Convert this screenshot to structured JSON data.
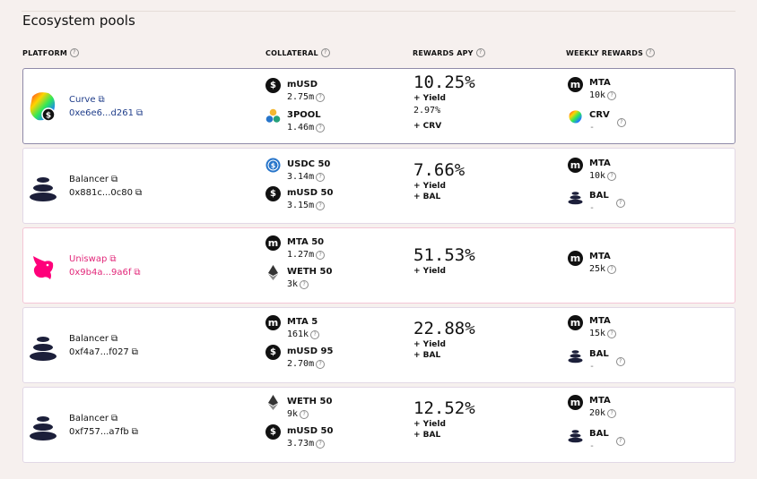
{
  "section_title": "Ecosystem pools",
  "headers": {
    "platform": "PLATFORM",
    "collateral": "COLLATERAL",
    "rewards_apy": "REWARDS APY",
    "weekly_rewards": "WEEKLY REWARDS"
  },
  "pools": [
    {
      "platform": "Curve",
      "address": "0xe6e6...d261",
      "collateral": [
        {
          "name": "mUSD",
          "value": "2.75m",
          "icon": "musd-icon"
        },
        {
          "name": "3POOL",
          "value": "1.46m",
          "icon": "3pool-icon"
        }
      ],
      "apy": "10.25%",
      "lines": [
        "+ Yield",
        "2.97%",
        "+ CRV"
      ],
      "rewards": [
        {
          "name": "MTA",
          "value": "10k",
          "icon": "mta-icon"
        },
        {
          "name": "CRV",
          "value": "-",
          "icon": "crv-icon"
        }
      ]
    },
    {
      "platform": "Balancer",
      "address": "0x881c...0c80",
      "collateral": [
        {
          "name": "USDC 50",
          "value": "3.14m",
          "icon": "usdc-icon"
        },
        {
          "name": "mUSD 50",
          "value": "3.15m",
          "icon": "musd-icon"
        }
      ],
      "apy": "7.66%",
      "lines": [
        "+ Yield",
        "+ BAL"
      ],
      "rewards": [
        {
          "name": "MTA",
          "value": "10k",
          "icon": "mta-icon"
        },
        {
          "name": "BAL",
          "value": "-",
          "icon": "bal-icon"
        }
      ]
    },
    {
      "platform": "Uniswap",
      "address": "0x9b4a...9a6f",
      "collateral": [
        {
          "name": "MTA 50",
          "value": "1.27m",
          "icon": "mta-icon"
        },
        {
          "name": "WETH 50",
          "value": "3k",
          "icon": "weth-icon"
        }
      ],
      "apy": "51.53%",
      "lines": [
        "+ Yield"
      ],
      "rewards": [
        {
          "name": "MTA",
          "value": "25k",
          "icon": "mta-icon"
        }
      ]
    },
    {
      "platform": "Balancer",
      "address": "0xf4a7...f027",
      "collateral": [
        {
          "name": "MTA 5",
          "value": "161k",
          "icon": "mta-icon"
        },
        {
          "name": "mUSD 95",
          "value": "2.70m",
          "icon": "musd-icon"
        }
      ],
      "apy": "22.88%",
      "lines": [
        "+ Yield",
        "+ BAL"
      ],
      "rewards": [
        {
          "name": "MTA",
          "value": "15k",
          "icon": "mta-icon"
        },
        {
          "name": "BAL",
          "value": "-",
          "icon": "bal-icon"
        }
      ]
    },
    {
      "platform": "Balancer",
      "address": "0xf757...a7fb",
      "collateral": [
        {
          "name": "WETH 50",
          "value": "9k",
          "icon": "weth-icon"
        },
        {
          "name": "mUSD 50",
          "value": "3.73m",
          "icon": "musd-icon"
        }
      ],
      "apy": "12.52%",
      "lines": [
        "+ Yield",
        "+ BAL"
      ],
      "rewards": [
        {
          "name": "MTA",
          "value": "20k",
          "icon": "mta-icon"
        },
        {
          "name": "BAL",
          "value": "-",
          "icon": "bal-icon"
        }
      ]
    }
  ],
  "colors": {
    "curve_link": "#1f3d8a",
    "uniswap_link": "#e2287a",
    "balancer_link": "#111111"
  }
}
